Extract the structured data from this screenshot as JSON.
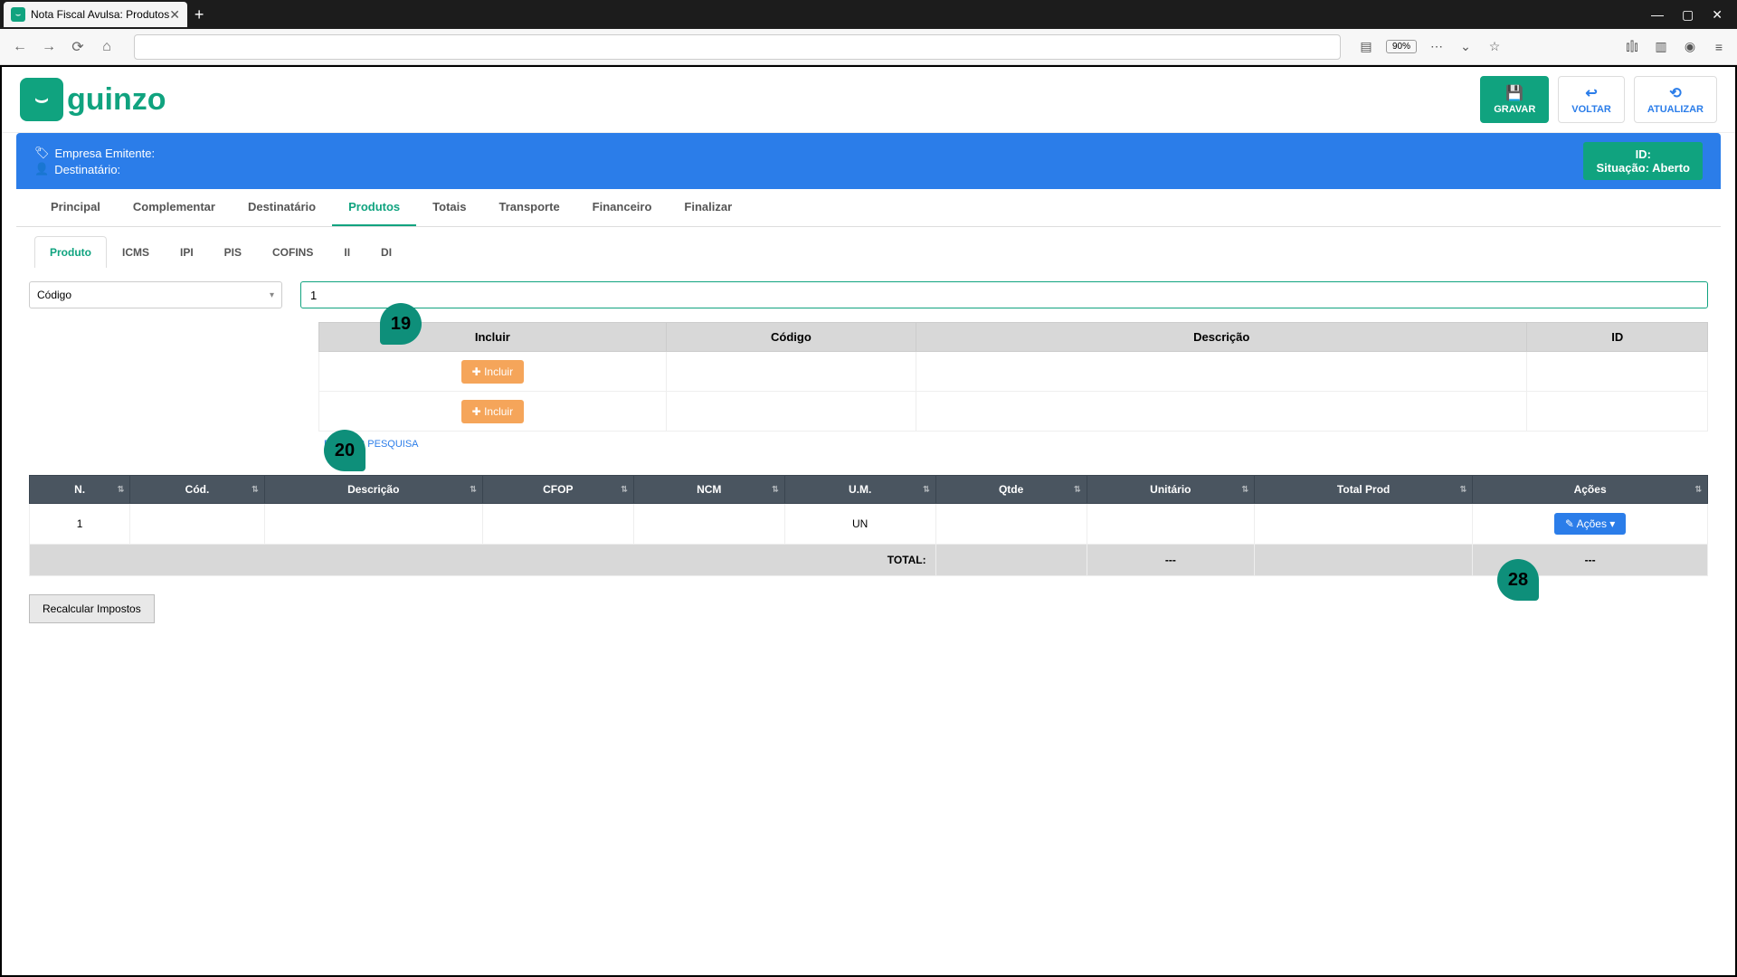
{
  "browser": {
    "tab_title": "Nota Fiscal Avulsa: Produtos",
    "zoom": "90%"
  },
  "window_controls": {
    "minimize": "—",
    "maximize": "▢",
    "close": "✕"
  },
  "logo": {
    "icon_glyph": "⌣",
    "text": "guinzo"
  },
  "header_actions": {
    "save": "GRAVAR",
    "back": "VOLTAR",
    "refresh": "ATUALIZAR"
  },
  "info_banner": {
    "emitter_label": "Empresa Emitente:",
    "recipient_label": "Destinatário:",
    "id_label": "ID:",
    "status_label": "Situação: Aberto"
  },
  "main_tabs": [
    "Principal",
    "Complementar",
    "Destinatário",
    "Produtos",
    "Totais",
    "Transporte",
    "Financeiro",
    "Finalizar"
  ],
  "main_tab_active": "Produtos",
  "sub_tabs": [
    "Produto",
    "ICMS",
    "IPI",
    "PIS",
    "COFINS",
    "II",
    "DI"
  ],
  "sub_tab_active": "Produto",
  "search": {
    "dropdown_value": "Código",
    "input_value": "1"
  },
  "search_table": {
    "headers": [
      "Incluir",
      "Código",
      "Descrição",
      "ID"
    ],
    "include_btn": "Incluir",
    "close_link": "FECHAR PESQUISA"
  },
  "data_table": {
    "headers": [
      "N.",
      "Cód.",
      "Descrição",
      "CFOP",
      "NCM",
      "U.M.",
      "Qtde",
      "Unitário",
      "Total Prod",
      "Ações"
    ],
    "rows": [
      {
        "n": "1",
        "cod": "",
        "desc": "",
        "cfop": "",
        "ncm": "",
        "um": "UN",
        "qtde": "",
        "unit": "",
        "total": "",
        "acoes": "Ações"
      }
    ],
    "total_label": "TOTAL:",
    "total_unit": "---",
    "total_acoes": "---",
    "acoes_btn": "Ações"
  },
  "recalc_btn": "Recalcular Impostos",
  "callouts": {
    "c19": "19",
    "c20": "20",
    "c28": "28"
  }
}
